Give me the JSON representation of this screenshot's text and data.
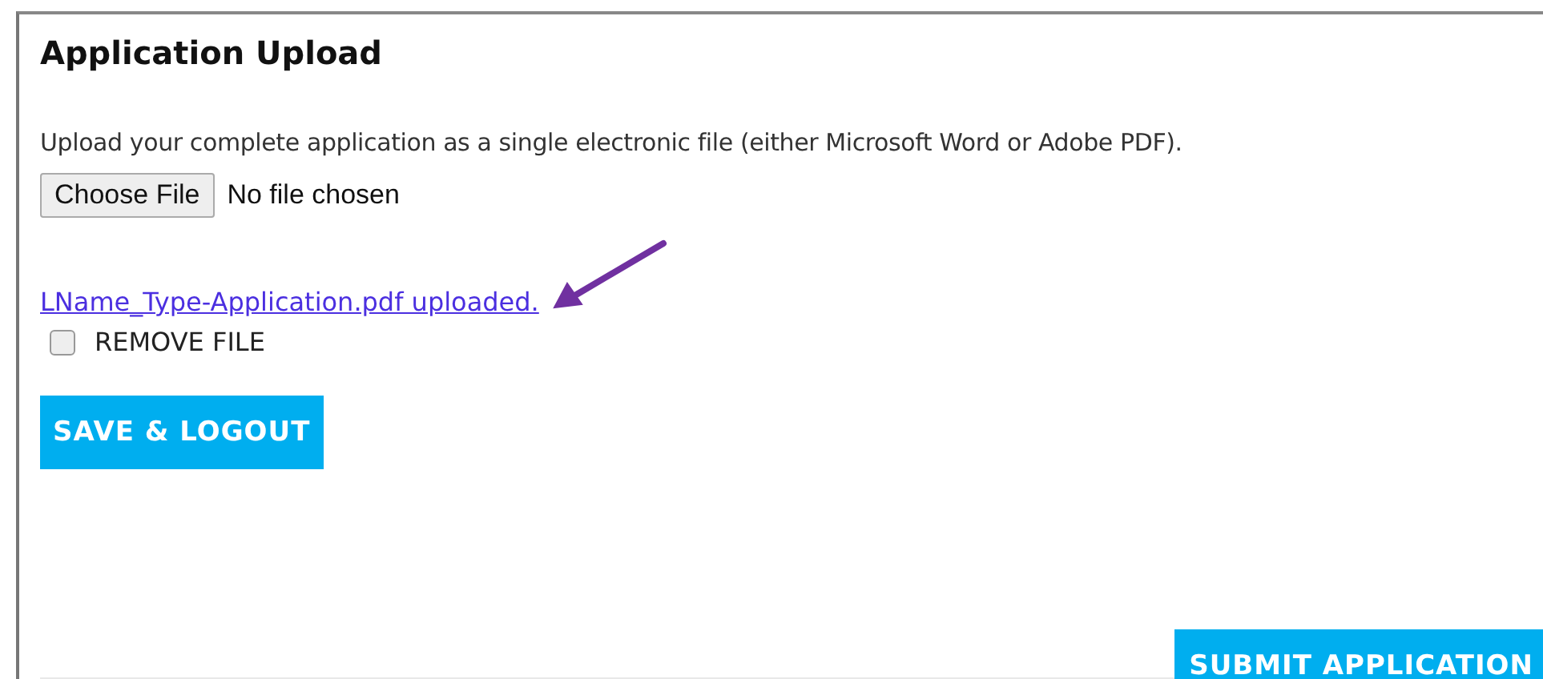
{
  "section": {
    "title": "Application Upload"
  },
  "instructions": "Upload your complete application as a single electronic file (either Microsoft Word or Adobe PDF).",
  "file_input": {
    "button_label": "Choose File",
    "status": "No file chosen"
  },
  "uploaded_file_link": "LName_Type-Application.pdf uploaded.",
  "remove_file": {
    "label": "REMOVE FILE",
    "checked": false
  },
  "buttons": [
    {
      "label": "SAVE & LOGOUT",
      "kind": "save"
    },
    {
      "label": "SUBMIT APPLICATION",
      "kind": "submit"
    }
  ]
}
